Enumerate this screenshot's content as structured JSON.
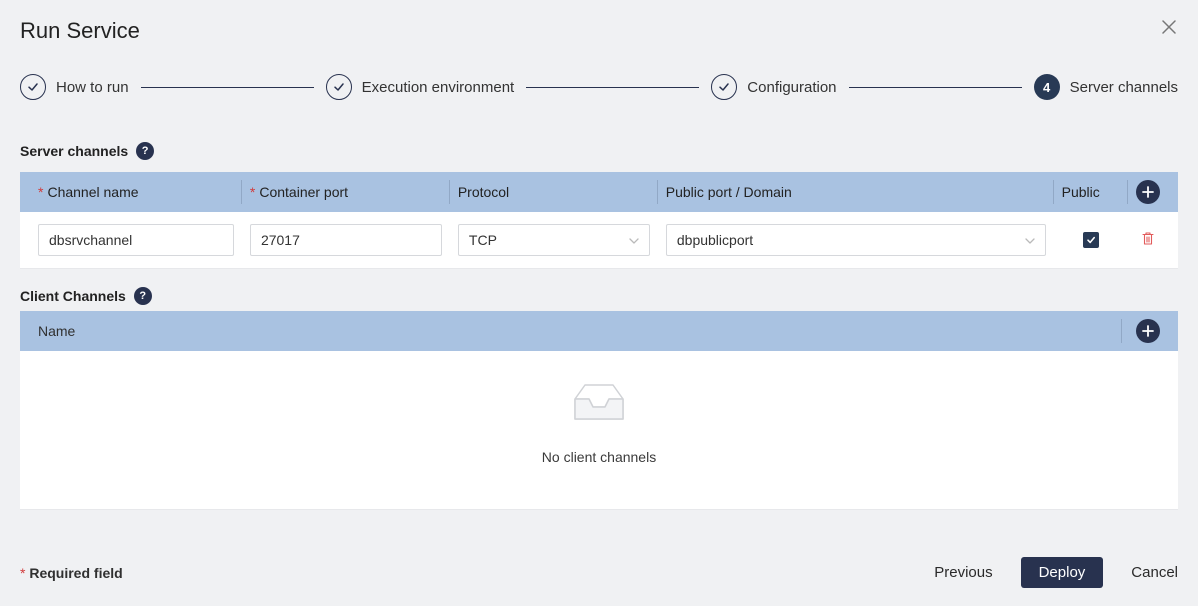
{
  "title": "Run Service",
  "steps": [
    {
      "label": "How to run",
      "done": true
    },
    {
      "label": "Execution environment",
      "done": true
    },
    {
      "label": "Configuration",
      "done": true
    },
    {
      "label": "Server channels",
      "active": true,
      "number": "4"
    }
  ],
  "server_channels": {
    "title": "Server channels",
    "headers": {
      "name": "Channel name",
      "port": "Container port",
      "protocol": "Protocol",
      "domain": "Public port / Domain",
      "public": "Public"
    },
    "row": {
      "name": "dbsrvchannel",
      "port": "27017",
      "protocol": "TCP",
      "domain": "dbpublicport",
      "public_checked": true
    }
  },
  "client_channels": {
    "title": "Client Channels",
    "header": "Name",
    "empty_text": "No client channels"
  },
  "footer": {
    "required": "Required field",
    "previous": "Previous",
    "deploy": "Deploy",
    "cancel": "Cancel"
  }
}
